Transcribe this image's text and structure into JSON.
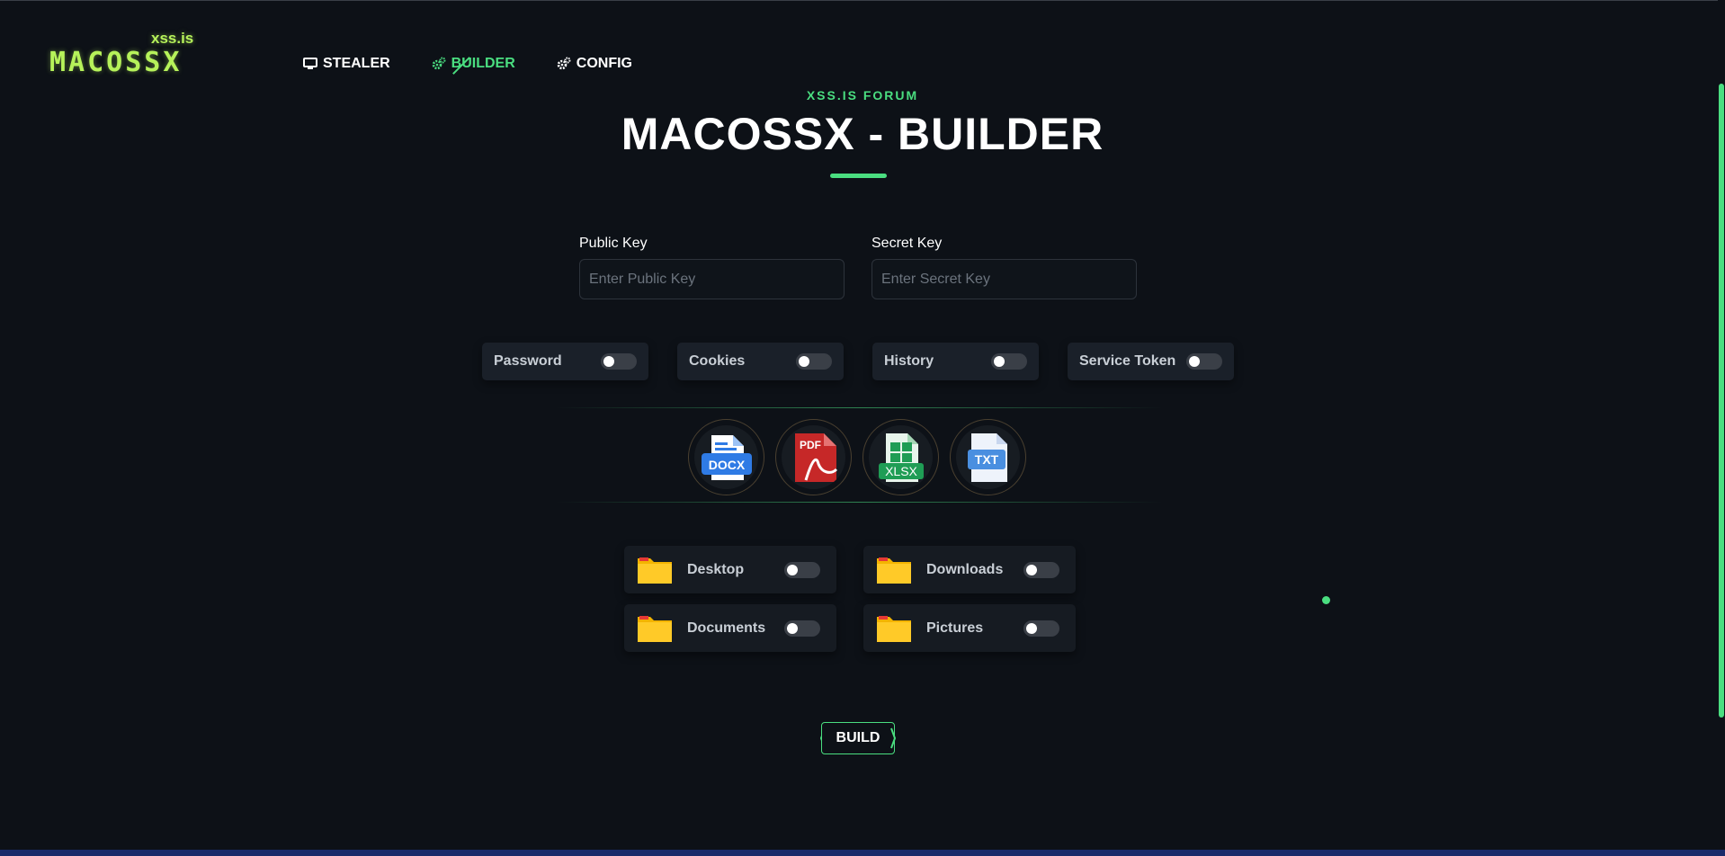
{
  "brand": {
    "name": "MACOSSX",
    "sub": "xss.is"
  },
  "nav": [
    {
      "label": "STEALER",
      "icon": "monitor-icon",
      "active": false
    },
    {
      "label": "BUILDER",
      "icon": "cogs-icon",
      "active": true
    },
    {
      "label": "CONFIG",
      "icon": "cogs-icon",
      "active": false
    }
  ],
  "header": {
    "eyebrow": "XSS.IS FORUM",
    "title": "MACOSSX - BUILDER"
  },
  "keys": {
    "public_label": "Public Key",
    "public_placeholder": "Enter Public Key",
    "public_value": "",
    "secret_label": "Secret Key",
    "secret_placeholder": "Enter Secret Key",
    "secret_value": ""
  },
  "options": [
    {
      "label": "Password",
      "enabled": false
    },
    {
      "label": "Cookies",
      "enabled": false
    },
    {
      "label": "History",
      "enabled": false
    },
    {
      "label": "Service Token",
      "enabled": false
    }
  ],
  "file_types": [
    {
      "label": "DOCX",
      "icon": "docx-file-icon",
      "color": "#2f7be5"
    },
    {
      "label": "PDF",
      "icon": "pdf-file-icon",
      "color": "#c62828"
    },
    {
      "label": "XLSX",
      "icon": "xlsx-file-icon",
      "color": "#1f9d55"
    },
    {
      "label": "TXT",
      "icon": "txt-file-icon",
      "color": "#4a8fe0"
    }
  ],
  "folders": [
    {
      "label": "Desktop",
      "enabled": false
    },
    {
      "label": "Downloads",
      "enabled": false
    },
    {
      "label": "Documents",
      "enabled": false
    },
    {
      "label": "Pictures",
      "enabled": false
    }
  ],
  "build_label": "BUILD",
  "colors": {
    "accent": "#4ade80",
    "logo": "#b6f25a",
    "background": "#0d1117",
    "card": "#1a2029"
  }
}
